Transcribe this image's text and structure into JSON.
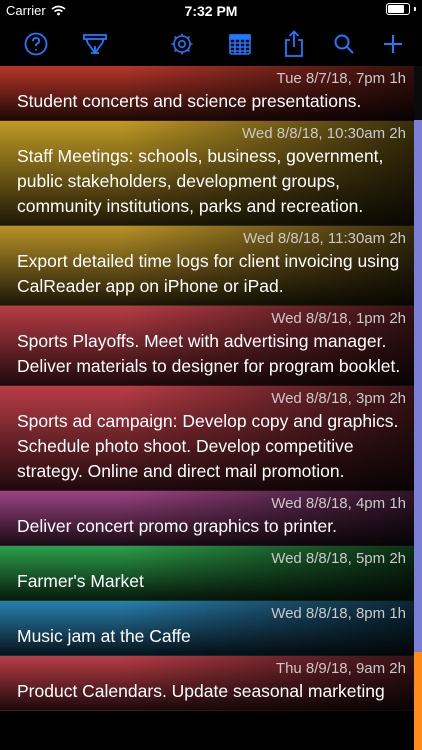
{
  "status": {
    "carrier": "Carrier",
    "time": "7:32 PM",
    "battery_level": 0.9
  },
  "toolbar": {
    "icons": [
      "help-icon",
      "timer-icon",
      "gear-icon",
      "calendar-icon",
      "share-icon",
      "search-icon",
      "add-icon"
    ],
    "accent": "#1d7bff"
  },
  "events": [
    {
      "when": "Tue 8/7/18, 7pm 1h",
      "title": "Student concerts and science presentations.",
      "color": "#c0392b"
    },
    {
      "when": "Wed 8/8/18, 10:30am 2h",
      "title": "Staff Meetings: schools, business, government, public stakeholders, development groups, community institutions, parks and recreation.",
      "color": "#c9a227"
    },
    {
      "when": "Wed 8/8/18, 11:30am 2h",
      "title": "Export detailed time logs for client invoicing using CalReader app on iPhone or iPad.",
      "color": "#c29a2a"
    },
    {
      "when": "Wed 8/8/18, 1pm 2h",
      "title": "Sports Playoffs. Meet with advertising manager. Deliver materials to designer for program booklet.",
      "color": "#c2404a"
    },
    {
      "when": "Wed 8/8/18, 3pm 2h",
      "title": "Sports ad campaign: Develop copy and graphics. Schedule photo shoot. Develop competitive strategy. Online and direct mail promotion.",
      "color": "#c2404a"
    },
    {
      "when": "Wed 8/8/18, 4pm 1h",
      "title": "Deliver concert promo graphics to printer.",
      "color": "#a4478a"
    },
    {
      "when": "Wed 8/8/18, 5pm 2h",
      "title": "Farmer's Market",
      "color": "#2ea84e"
    },
    {
      "when": "Wed 8/8/18, 8pm 1h",
      "title": "Music jam at the Caffe",
      "color": "#2a87b8"
    },
    {
      "when": "Thu 8/9/18, 9am 2h",
      "title": "Product Calendars. Update seasonal marketing",
      "color": "#c2404a"
    }
  ],
  "scrollbar_colors": [
    "#7b7fd6",
    "#ff8c1a"
  ]
}
